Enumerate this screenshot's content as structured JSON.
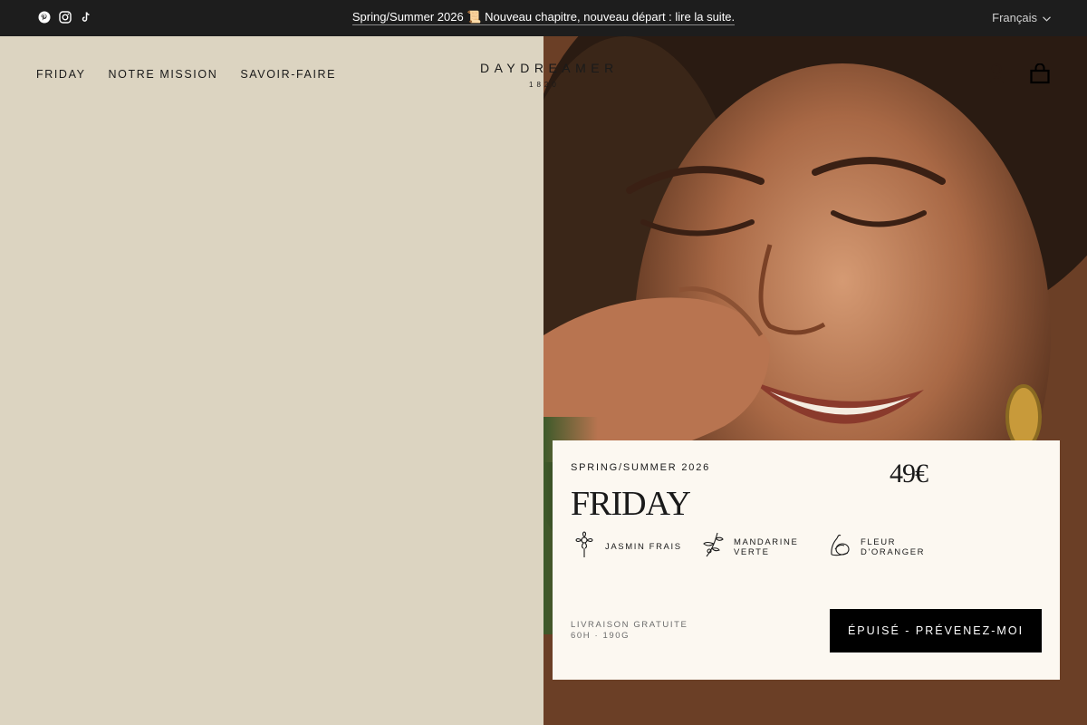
{
  "announcement": {
    "text": "Spring/Summer 2026 📜 Nouveau chapitre, nouveau départ : lire la suite.",
    "socials": [
      {
        "icon": "pinterest-icon"
      },
      {
        "icon": "instagram-icon"
      },
      {
        "icon": "tiktok-icon"
      }
    ],
    "language": "Français"
  },
  "nav": {
    "items": [
      {
        "label": "FRIDAY"
      },
      {
        "label": "NOTRE MISSION"
      },
      {
        "label": "SAVOIR-FAIRE"
      }
    ]
  },
  "logo": {
    "name": "DAYDREAMER",
    "year": "1820"
  },
  "header_icons": {
    "account": "account-icon",
    "cart": "cart-icon"
  },
  "product": {
    "collection": "SPRING/SUMMER 2026",
    "name": "FRIDAY",
    "price": "49€",
    "notes": [
      {
        "label_line1": "JASMIN FRAIS",
        "label_line2": "",
        "icon": "jasmine-icon"
      },
      {
        "label_line1": "MANDARINE",
        "label_line2": "VERTE",
        "icon": "mandarin-icon"
      },
      {
        "label_line1": "FLEUR",
        "label_line2": "D'ORANGER",
        "icon": "orange-blossom-icon"
      }
    ],
    "shipping_line1": "LIVRAISON GRATUITE",
    "shipping_line2": "60H · 190G",
    "cta_label": "ÉPUISÉ - PRÉVENEZ-MOI"
  },
  "colors": {
    "announcement_bg": "#1d1d1d",
    "page_bg": "#dcd4c1",
    "card_bg": "#fcf8f1",
    "cta_bg": "#000000"
  }
}
